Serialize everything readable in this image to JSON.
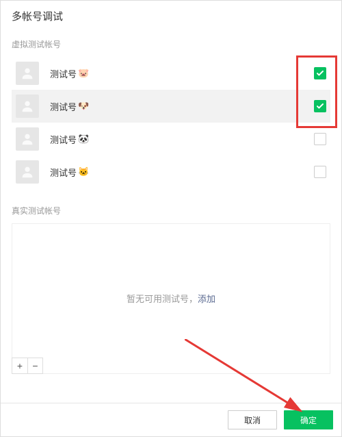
{
  "title": "多帐号调试",
  "sections": {
    "virtual_label": "虚拟测试帐号",
    "real_label": "真实测试帐号"
  },
  "virtual_accounts": [
    {
      "name": "测试号",
      "emoji": "🐷",
      "checked": true,
      "selected": false
    },
    {
      "name": "测试号",
      "emoji": "🐶",
      "checked": true,
      "selected": true
    },
    {
      "name": "测试号",
      "emoji": "🐼",
      "checked": false,
      "selected": false
    },
    {
      "name": "测试号",
      "emoji": "🐱",
      "checked": false,
      "selected": false
    }
  ],
  "empty_state": {
    "text": "暂无可用测试号，",
    "link_label": "添加"
  },
  "controls": {
    "plus": "+",
    "minus": "−"
  },
  "footer": {
    "cancel_label": "取消",
    "confirm_label": "确定"
  },
  "colors": {
    "primary": "#07c160",
    "highlight": "#e53935"
  }
}
